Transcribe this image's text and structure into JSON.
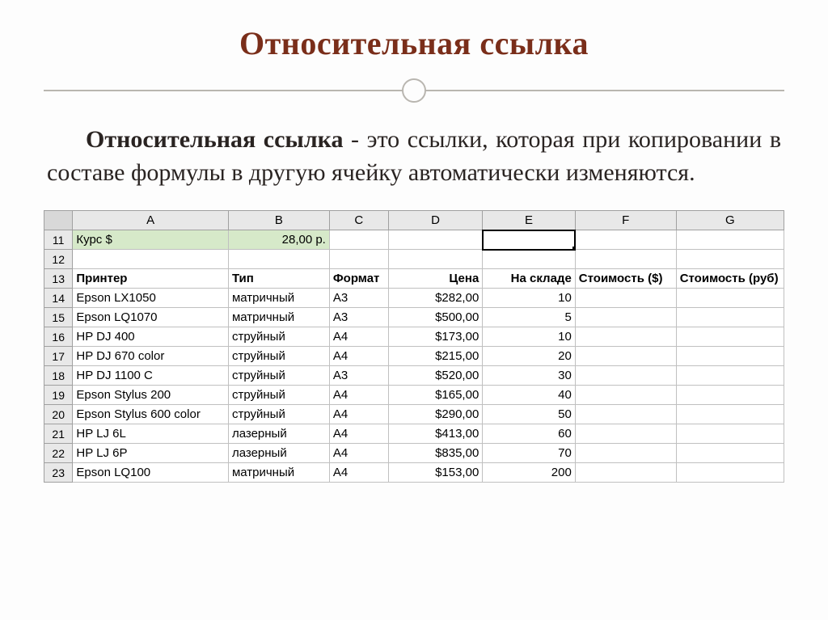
{
  "title": "Относительная ссылка",
  "paragraph": {
    "lead": "Относительная ссылка",
    "rest": " - это ссылки, которая при копировании в составе формулы в другую ячейку автоматически изменяются."
  },
  "chart_data": {
    "type": "table",
    "columns": [
      "A",
      "B",
      "C",
      "D",
      "E",
      "F",
      "G"
    ],
    "row_numbers": [
      11,
      12,
      13,
      14,
      15,
      16,
      17,
      18,
      19,
      20,
      21,
      22,
      23
    ],
    "selected_cell": "E11",
    "rows": [
      {
        "n": 11,
        "A": "Курс $",
        "B": "28,00 р.",
        "C": "",
        "D": "",
        "E": "",
        "F": "",
        "G": "",
        "style": "green",
        "B_align": "right"
      },
      {
        "n": 12,
        "A": "",
        "B": "",
        "C": "",
        "D": "",
        "E": "",
        "F": "",
        "G": ""
      },
      {
        "n": 13,
        "A": "Принтер",
        "B": "Тип",
        "C": "Формат",
        "D": "Цена",
        "E": "На складе",
        "F": "Стоимость ($)",
        "G": "Стоимость (руб)",
        "bold": true
      },
      {
        "n": 14,
        "A": "Epson LX1050",
        "B": "матричный",
        "C": "A3",
        "D": "$282,00",
        "E": "10",
        "F": "",
        "G": ""
      },
      {
        "n": 15,
        "A": "Epson LQ1070",
        "B": "матричный",
        "C": "A3",
        "D": "$500,00",
        "E": "5",
        "F": "",
        "G": ""
      },
      {
        "n": 16,
        "A": "HP DJ 400",
        "B": "струйный",
        "C": "A4",
        "D": "$173,00",
        "E": "10",
        "F": "",
        "G": ""
      },
      {
        "n": 17,
        "A": "HP DJ 670 color",
        "B": "струйный",
        "C": "A4",
        "D": "$215,00",
        "E": "20",
        "F": "",
        "G": ""
      },
      {
        "n": 18,
        "A": "HP DJ 1100 C",
        "B": "струйный",
        "C": "A3",
        "D": "$520,00",
        "E": "30",
        "F": "",
        "G": ""
      },
      {
        "n": 19,
        "A": "Epson Stylus 200",
        "B": "струйный",
        "C": "A4",
        "D": "$165,00",
        "E": "40",
        "F": "",
        "G": ""
      },
      {
        "n": 20,
        "A": "Epson Stylus 600 color",
        "B": "струйный",
        "C": "A4",
        "D": "$290,00",
        "E": "50",
        "F": "",
        "G": ""
      },
      {
        "n": 21,
        "A": "HP LJ 6L",
        "B": "лазерный",
        "C": "A4",
        "D": "$413,00",
        "E": "60",
        "F": "",
        "G": ""
      },
      {
        "n": 22,
        "A": "HP LJ 6P",
        "B": "лазерный",
        "C": "A4",
        "D": "$835,00",
        "E": "70",
        "F": "",
        "G": ""
      },
      {
        "n": 23,
        "A": "Epson LQ100",
        "B": "матричный",
        "C": "A4",
        "D": "$153,00",
        "E": "200",
        "F": "",
        "G": ""
      }
    ]
  }
}
